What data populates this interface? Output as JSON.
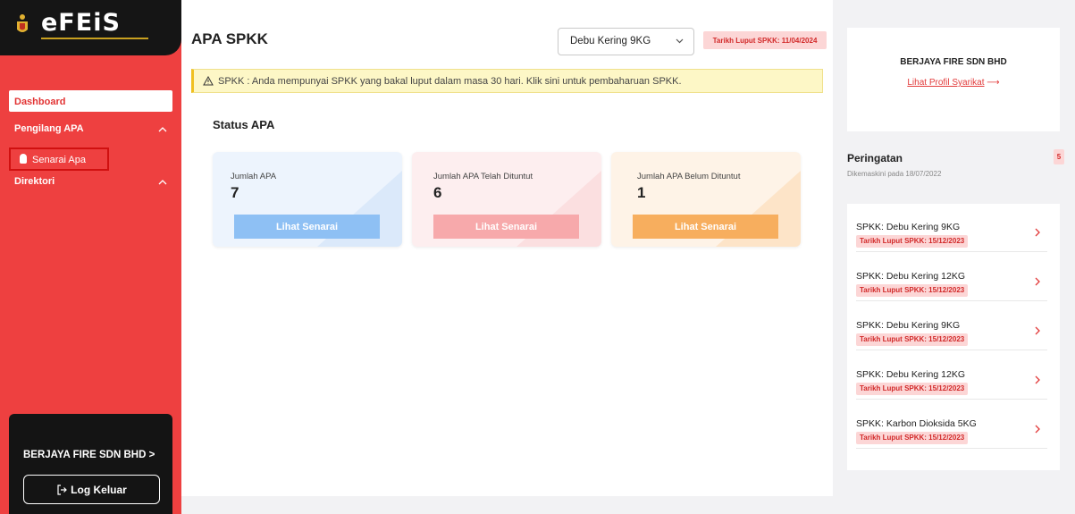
{
  "brand": {
    "logo_text": "eFEiS"
  },
  "sidebar": {
    "dashboard_label": "Dashboard",
    "groups": [
      {
        "label": "Pengilang APA",
        "items": [
          {
            "label": "Senarai Apa"
          }
        ]
      },
      {
        "label": "Direktori",
        "items": []
      }
    ],
    "company_name": "BERJAYA FIRE SDN BHD >",
    "logout_label": "Log Keluar"
  },
  "header": {
    "title": "APA SPKK",
    "select_value": "Debu Kering 9KG",
    "expiry_badge": "Tarikh Luput SPKK: 11/04/2024"
  },
  "warning": {
    "text": "SPKK : Anda mempunyai SPKK yang bakal luput dalam masa 30 hari. Klik sini untuk pembaharuan SPKK."
  },
  "status": {
    "title": "Status APA",
    "cards": [
      {
        "label": "Jumlah APA",
        "value": "7",
        "button": "Lihat Senarai",
        "color": "#8ec0f4"
      },
      {
        "label": "Jumlah APA Telah Dituntut",
        "value": "6",
        "button": "Lihat Senarai",
        "color": "#f7a9ab"
      },
      {
        "label": "Jumlah APA Belum Dituntut",
        "value": "1",
        "button": "Lihat Senarai",
        "color": "#f7ae5e"
      }
    ]
  },
  "company_panel": {
    "name": "BERJAYA FIRE SDN BHD",
    "link": "Lihat Profil Syarikat",
    "arrow": "⟶"
  },
  "alerts": {
    "title": "Peringatan",
    "updated": "Dikemaskini pada 18/07/2022",
    "count": "5",
    "items": [
      {
        "title": "SPKK: Debu Kering 9KG",
        "badge": "Tarikh Luput SPKK: 15/12/2023"
      },
      {
        "title": "SPKK: Debu Kering 12KG",
        "badge": "Tarikh Luput SPKK: 15/12/2023"
      },
      {
        "title": "SPKK: Debu Kering 9KG",
        "badge": "Tarikh Luput SPKK: 15/12/2023"
      },
      {
        "title": "SPKK: Debu Kering 12KG",
        "badge": "Tarikh Luput SPKK: 15/12/2023"
      },
      {
        "title": "SPKK: Karbon Dioksida 5KG",
        "badge": "Tarikh Luput SPKK: 15/12/2023"
      }
    ]
  },
  "colors": {
    "sidebar": "#ee4040",
    "accent": "#e23b3b",
    "badge_bg": "#fcd6d6"
  }
}
